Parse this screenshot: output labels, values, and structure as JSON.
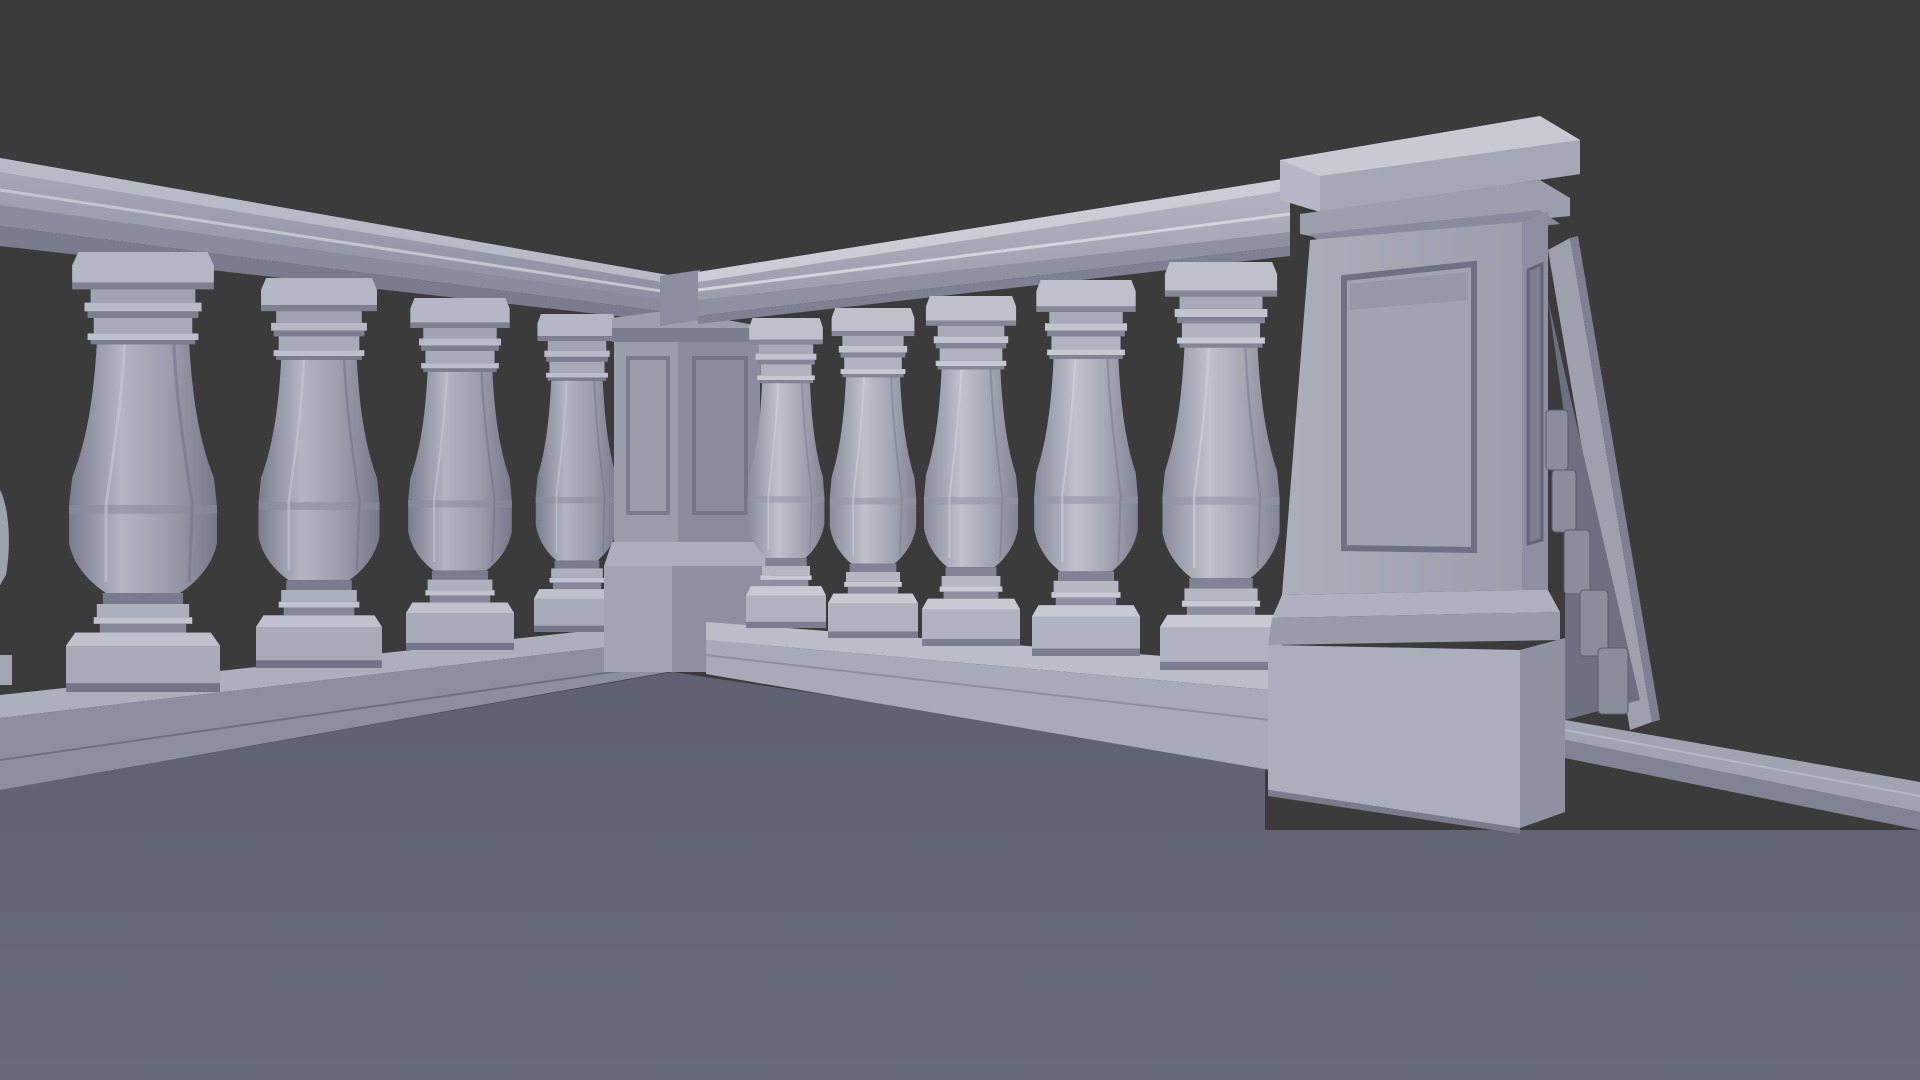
{
  "viewport": {
    "background_color": "#3b3b3c",
    "floor_color": "#676876",
    "stone_light": "#b9bac7",
    "stone_mid": "#9c9daa",
    "stone_dark": "#6f7080",
    "stone_shadow": "#505160"
  },
  "scene": {
    "left_balusters_count": 5,
    "right_balusters_count": 5
  }
}
